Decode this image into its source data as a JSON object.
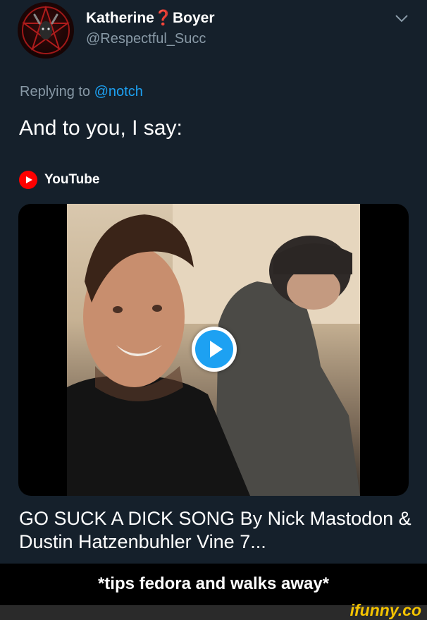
{
  "header": {
    "display_name": "Katherine❓Boyer",
    "handle": "@Respectful_Succ"
  },
  "reply": {
    "prefix": "Replying to ",
    "mention": "@notch"
  },
  "tweet": {
    "text": "And to you, I say:"
  },
  "embed": {
    "source_label": "YouTube",
    "video_title": "GO SUCK A DICK SONG By Nick Mastodon & Dustin Hatzenbuhler Vine 7..."
  },
  "meme": {
    "caption": "*tips fedora and walks away*",
    "watermark": "ifunny.co"
  },
  "colors": {
    "background": "#15202b",
    "muted_text": "#8899a6",
    "accent": "#1da1f2",
    "youtube_red": "#ff0000",
    "watermark_yellow": "#f5c400"
  },
  "icons": {
    "avatar": "pentagram-goat-avatar",
    "menu": "chevron-down-icon",
    "youtube": "youtube-logo-icon",
    "play": "play-icon"
  }
}
